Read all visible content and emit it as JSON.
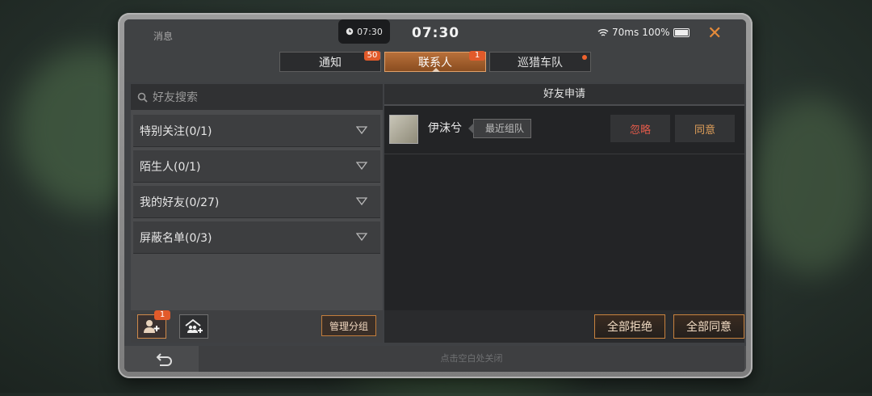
{
  "header": {
    "title": "消息",
    "pill_time": "07:30",
    "clock": "07:30",
    "ping": "70ms",
    "battery": "100%"
  },
  "tabs": [
    {
      "label": "通知",
      "badge": "50"
    },
    {
      "label": "联系人",
      "badge": "1",
      "active": true
    },
    {
      "label": "巡猎车队",
      "dot": true
    }
  ],
  "search": {
    "placeholder": "好友搜索"
  },
  "groups": [
    {
      "label": "特别关注(0/1)"
    },
    {
      "label": "陌生人(0/1)"
    },
    {
      "label": "我的好友(0/27)"
    },
    {
      "label": "屏蔽名单(0/3)"
    }
  ],
  "left_bottom": {
    "add_friend_badge": "1",
    "manage_label": "管理分组"
  },
  "right": {
    "title": "好友申请",
    "request": {
      "name": "伊沫兮",
      "tag": "最近组队",
      "ignore_label": "忽略",
      "agree_label": "同意"
    },
    "reject_all_label": "全部拒绝",
    "agree_all_label": "全部同意"
  },
  "footer": {
    "hint": "点击空白处关闭"
  },
  "colors": {
    "accent": "#c8823e",
    "badge": "#e25a2a",
    "ignore": "#e05a4a"
  }
}
